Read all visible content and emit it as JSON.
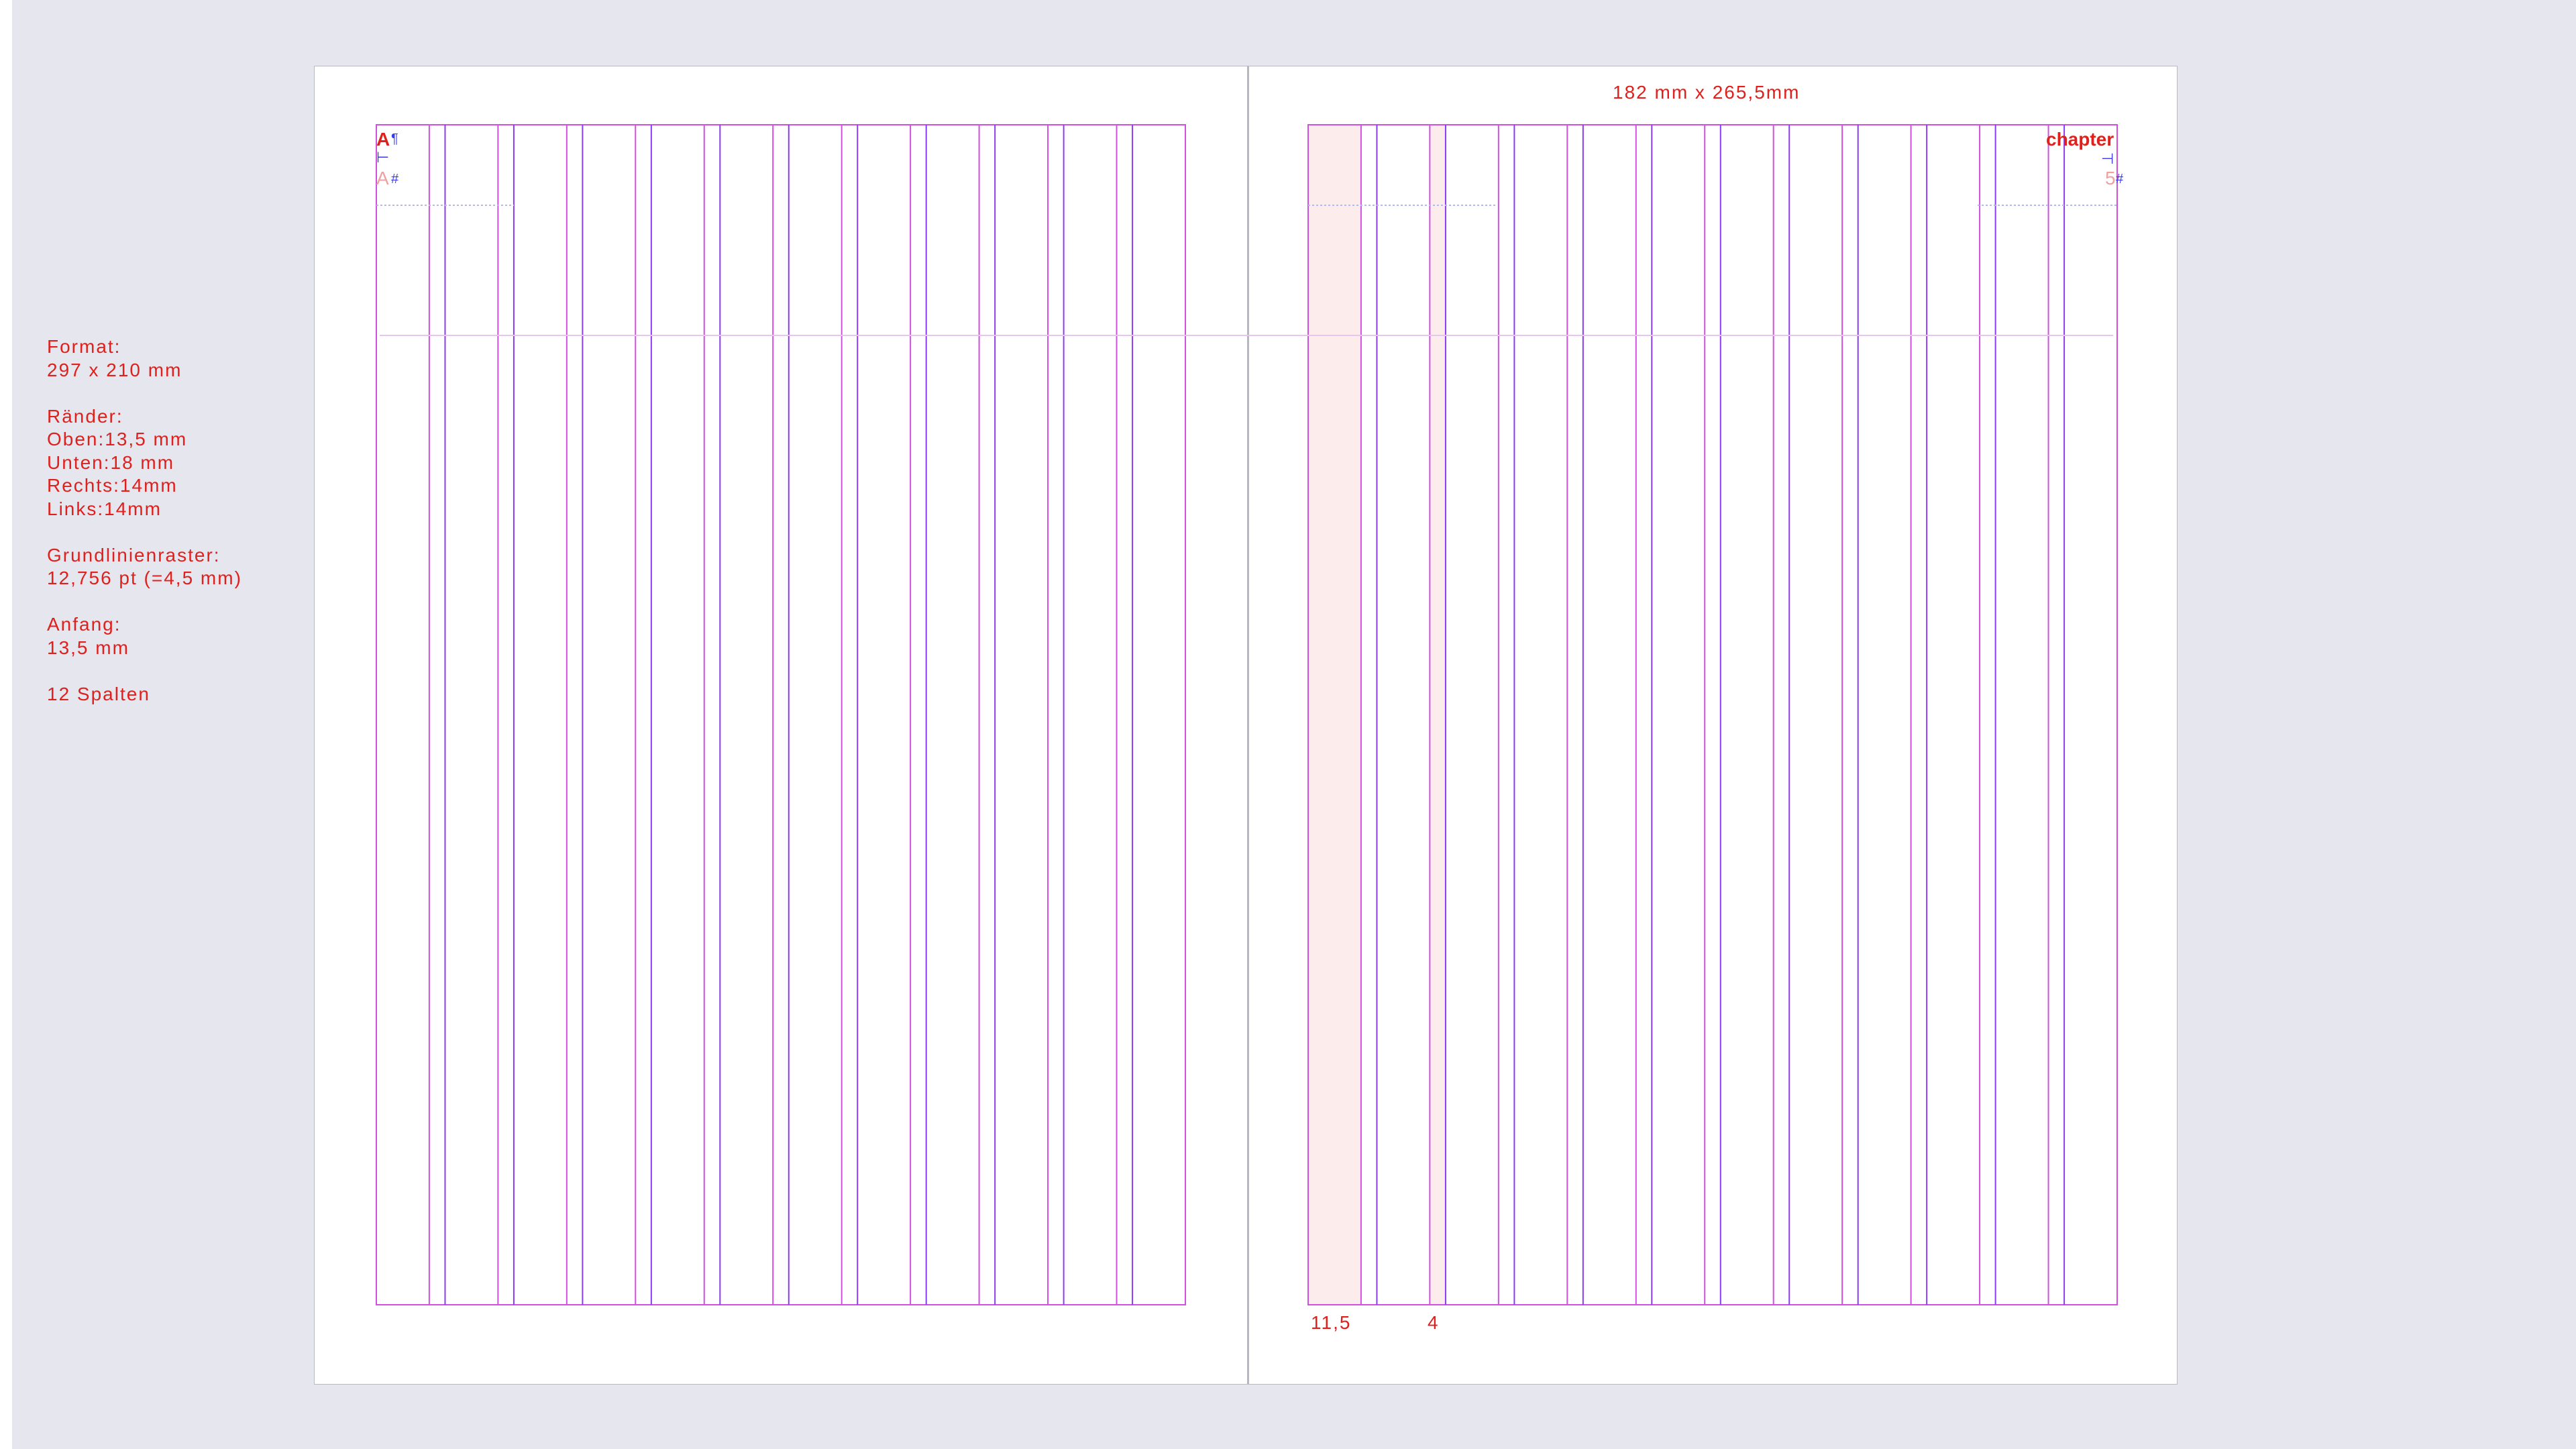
{
  "colors": {
    "background": "#e6e6ee",
    "page": "#ffffff",
    "margin_guide": "#d050e0",
    "column_guide": "#8c3cf0",
    "annotation_text": "#e0201c",
    "highlight": "#fdecec"
  },
  "spec_panel": {
    "blocks": [
      [
        "Format:",
        "297 x 210 mm"
      ],
      [
        "Ränder:",
        "Oben:13,5 mm",
        "Unten:18 mm",
        "Rechts:14mm",
        "Links:14mm"
      ],
      [
        "Grundlinienraster:",
        "12,756 pt (=4,5 mm)"
      ],
      [
        "Anfang:",
        "13,5 mm"
      ],
      [
        "12 Spalten"
      ]
    ]
  },
  "right_page": {
    "dimension_label": "182 mm x 265,5mm",
    "column_width_label": "11,5",
    "gutter_width_label": "4",
    "header_text": "chapter",
    "page_number": "5"
  },
  "left_page": {
    "header_text": "A",
    "page_marker": "A"
  },
  "grid": {
    "columns": 12
  }
}
